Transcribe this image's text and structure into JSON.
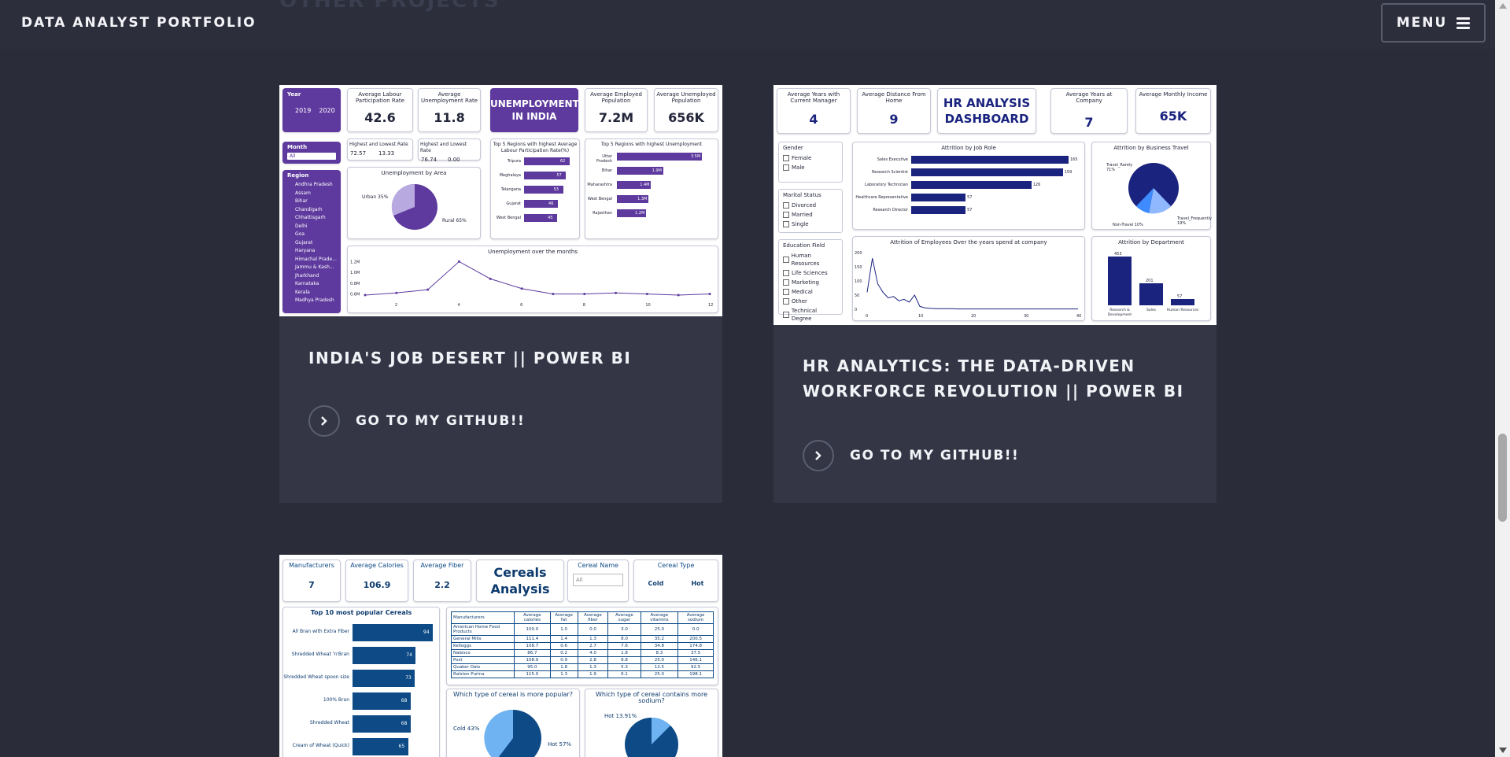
{
  "header": {
    "brand": "DATA ANALYST PORTFOLIO",
    "menu_label": "MENU",
    "faded_section_heading": "OTHER PROJECTS"
  },
  "projects": [
    {
      "title": "INDIA'S JOB DESERT || POWER BI",
      "link_label": "GO TO MY GITHUB!!",
      "dashboard": {
        "title_lines": [
          "UNEMPLOYMENT",
          "IN INDIA"
        ],
        "year_label": "Year",
        "years": [
          "2019",
          "2020"
        ],
        "month_label": "Month",
        "month_value": "All",
        "region_label": "Region",
        "regions": [
          "Andhra Pradesh",
          "Assam",
          "Bihar",
          "Chandigarh",
          "Chhattisgarh",
          "Delhi",
          "Goa",
          "Gujarat",
          "Haryana",
          "Himachal Prade...",
          "Jammu & Kash...",
          "Jharkhand",
          "Karnataka",
          "Kerala",
          "Madhya Pradesh"
        ],
        "kpis": [
          {
            "label": "Average Labour Participation Rate",
            "value": "42.6"
          },
          {
            "label": "Average Unemployment Rate",
            "value": "11.8"
          },
          {
            "label": "Average Employed Population",
            "value": "7.2M"
          },
          {
            "label": "Average Unemployed Population",
            "value": "656K"
          }
        ],
        "hl_labour": {
          "label": "Highest and Lowest Rate",
          "hi": "72.57",
          "lo": "13.33"
        },
        "hl_unemp": {
          "label": "Highest and Lowest Rate",
          "hi": "76.74",
          "lo": "0.00"
        },
        "pie": {
          "title": "Unemployment by Area",
          "urban": "Urban 35%",
          "rural": "Rural 65%"
        },
        "top_lpr": {
          "title": "Top 5 Regions with highest Average Labour Participation Rate(%)",
          "items": [
            {
              "name": "Tripura",
              "value": 62
            },
            {
              "name": "Meghalaya",
              "value": 57
            },
            {
              "name": "Telangana",
              "value": 53
            },
            {
              "name": "Gujarat",
              "value": 46
            },
            {
              "name": "West Bengal",
              "value": 45
            }
          ]
        },
        "top_unemp": {
          "title": "Top 5 Regions with highest Unemployment",
          "items": [
            {
              "name": "Uttar Pradesh",
              "label": "3.5M",
              "value": 3.5
            },
            {
              "name": "Bihar",
              "label": "1.9M",
              "value": 1.9
            },
            {
              "name": "Maharashtra",
              "label": "1.4M",
              "value": 1.4
            },
            {
              "name": "West Bengal",
              "label": "1.3M",
              "value": 1.3
            },
            {
              "name": "Rajasthan",
              "label": "1.2M",
              "value": 1.2
            }
          ]
        },
        "line": {
          "title": "Unemployment over the months",
          "yticks": [
            "1.2M",
            "1.0M",
            "0.8M",
            "0.6M"
          ],
          "xticks": [
            "2",
            "4",
            "6",
            "8",
            "10",
            "12"
          ],
          "values": [
            0.58,
            0.62,
            0.68,
            1.2,
            0.88,
            0.7,
            0.6,
            0.6,
            0.62,
            0.6,
            0.58,
            0.6
          ]
        }
      }
    },
    {
      "title": "HR ANALYTICS: THE DATA-DRIVEN WORKFORCE REVOLUTION || POWER BI",
      "link_label": "GO TO MY GITHUB!!",
      "dashboard": {
        "title_lines": [
          "HR ANALYSIS",
          "DASHBOARD"
        ],
        "kpis": [
          {
            "label": "Average Years with Current Manager",
            "value": "4"
          },
          {
            "label": "Average Distance From Home",
            "value": "9"
          },
          {
            "label": "Average Years at Company",
            "value": "7"
          },
          {
            "label": "Average Monthly Income",
            "value": "65K"
          }
        ],
        "slicers": [
          {
            "label": "Gender",
            "options": [
              "Female",
              "Male"
            ]
          },
          {
            "label": "Marital Status",
            "options": [
              "Divorced",
              "Married",
              "Single"
            ]
          },
          {
            "label": "Education Field",
            "options": [
              "Human Resources",
              "Life Sciences",
              "Marketing",
              "Medical",
              "Other",
              "Technical Degree"
            ]
          }
        ],
        "job_role": {
          "title": "Attrition by Job Role",
          "items": [
            {
              "name": "Sales Executive",
              "value": 165
            },
            {
              "name": "Research Scientist",
              "value": 159
            },
            {
              "name": "Laboratory Technician",
              "value": 126
            },
            {
              "name": "Healthcare Representative",
              "value": 57
            },
            {
              "name": "Research Director",
              "value": 57
            }
          ]
        },
        "travel": {
          "title": "Attrition by Business Travel",
          "labels": [
            "Travel_Rarely 71%",
            "Travel_Frequently 19%",
            "Non-Travel 10%"
          ]
        },
        "years_chart": {
          "title": "Attrition of Employees Over the years spend at company",
          "yticks": [
            "200",
            "150",
            "100",
            "50",
            "0"
          ],
          "xticks": [
            "0",
            "10",
            "20",
            "30",
            "40"
          ]
        },
        "dept": {
          "title": "Attrition by Department",
          "items": [
            {
              "name": "Research & Development",
              "value": 453
            },
            {
              "name": "Sales",
              "value": 201
            },
            {
              "name": "Human Resources",
              "value": 57
            }
          ]
        }
      }
    },
    {
      "dashboard": {
        "title_lines": [
          "Cereals",
          "Analysis"
        ],
        "kpis": [
          {
            "label": "Manufacturers",
            "value": "7"
          },
          {
            "label": "Average Calories",
            "value": "106.9"
          },
          {
            "label": "Average Fiber",
            "value": "2.2"
          }
        ],
        "cereal_name": {
          "label": "Cereal Name",
          "value": "All"
        },
        "cereal_type": {
          "label": "Cereal Type",
          "options": [
            "Cold",
            "Hot"
          ]
        },
        "popular": {
          "title": "Top 10 most popular Cereals",
          "items": [
            {
              "name": "All Bran with Extra Fiber",
              "value": 94
            },
            {
              "name": "Shredded Wheat 'n'Bran",
              "value": 74
            },
            {
              "name": "Shredded Wheat spoon size",
              "value": 73
            },
            {
              "name": "100% Bran",
              "value": 68
            },
            {
              "name": "Shredded Wheat",
              "value": 68
            },
            {
              "name": "Cream of Wheat (Quick)",
              "value": 65
            }
          ]
        },
        "table": {
          "headers": [
            "Manufacturers",
            "Average calories",
            "Average fat",
            "Average fiber",
            "Average sugar",
            "Average vitamins",
            "Average sodium"
          ],
          "rows": [
            [
              "American Home Food Products",
              "100.0",
              "1.0",
              "0.0",
              "3.0",
              "25.0",
              "0.0"
            ],
            [
              "General Mills",
              "111.4",
              "1.4",
              "1.3",
              "8.0",
              "35.2",
              "200.5"
            ],
            [
              "Kelloggs",
              "108.7",
              "0.6",
              "2.7",
              "7.6",
              "34.8",
              "174.8"
            ],
            [
              "Nabisco",
              "86.7",
              "0.2",
              "4.0",
              "1.8",
              "8.3",
              "37.5"
            ],
            [
              "Post",
              "108.9",
              "0.9",
              "2.8",
              "8.8",
              "25.0",
              "146.1"
            ],
            [
              "Quaker Oats",
              "95.0",
              "1.8",
              "1.3",
              "5.3",
              "12.5",
              "92.5"
            ],
            [
              "Ralston Purina",
              "115.0",
              "1.3",
              "1.9",
              "6.1",
              "25.0",
              "198.1"
            ]
          ]
        },
        "pie_popular": {
          "title": "Which type of cereal is more popular?",
          "labels": [
            "Cold 43%",
            "Hot 57%"
          ]
        },
        "pie_sodium": {
          "title": "Which type of cereal contains more sodium?",
          "labels": [
            "Hot 13.91%"
          ]
        }
      }
    }
  ],
  "colors": {
    "page_bg": "#2a2c3a",
    "card_bg": "#343646",
    "india_purple": "#5e3a9e",
    "hr_blue": "#1a237e",
    "cereal_blue": "#0d4a86",
    "light_blue": "#6fb3f2"
  }
}
